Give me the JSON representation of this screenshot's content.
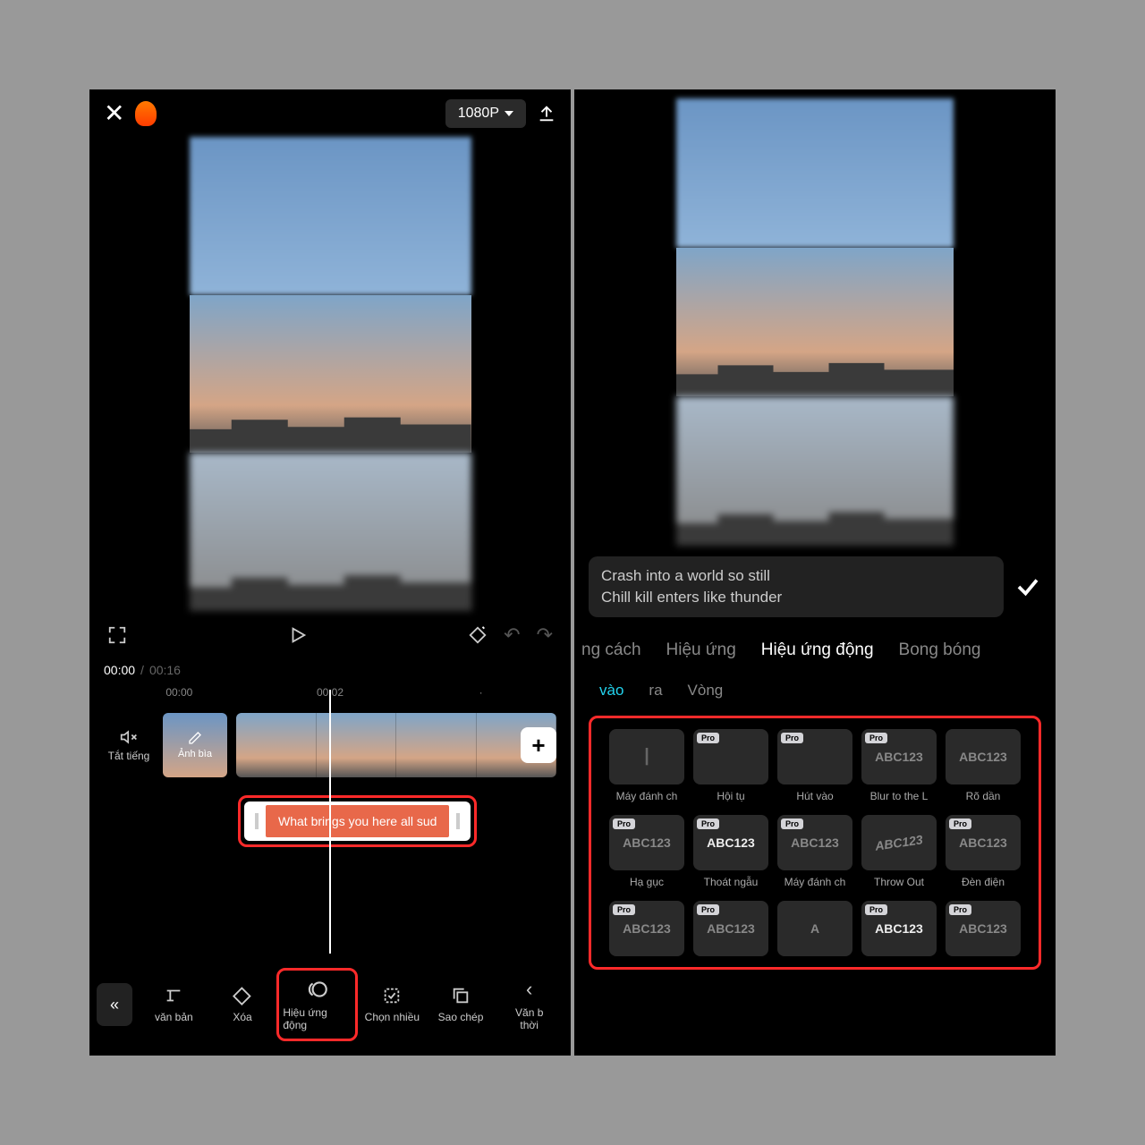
{
  "left": {
    "resolution": "1080P",
    "overlay": {
      "line1": "What brings you here all sudden?",
      "line2": "Crash into a world so still",
      "line3": "Chill kill enters like thunder"
    },
    "time": {
      "current": "00:00",
      "total": "00:16"
    },
    "marks": {
      "t1": "00:00",
      "t2": "00:02"
    },
    "mute": "Tắt tiếng",
    "cover": "Ảnh bìa",
    "textClip": "What brings you here all sud",
    "tools": {
      "text": "văn bản",
      "delete": "Xóa",
      "anim": "Hiệu ứng động",
      "multi": "Chọn nhiều",
      "copy": "Sao chép",
      "time": "Văn b\nthời"
    }
  },
  "right": {
    "overlay": {
      "line1": "What brings you here all sudden?",
      "line2": "Crash into a world so still",
      "line3": "Chill kill enters like thunder"
    },
    "lyrics": {
      "l1": "Crash into a world so still",
      "l2": "Chill kill enters like thunder"
    },
    "tabs": {
      "t1": "ng cách",
      "t2": "Hiệu ứng",
      "t3": "Hiệu ứng động",
      "t4": "Bong bóng"
    },
    "subtabs": {
      "s1": "vào",
      "s2": "ra",
      "s3": "Vòng"
    },
    "pro": "Pro",
    "abc": "ABC123",
    "fx": [
      {
        "label": "Máy đánh ch",
        "txt": "",
        "pro": false
      },
      {
        "label": "Hội tụ",
        "txt": "",
        "pro": true
      },
      {
        "label": "Hút vào",
        "txt": "",
        "pro": true
      },
      {
        "label": "Blur to the L",
        "txt": "ABC123",
        "pro": true
      },
      {
        "label": "Rõ dần",
        "txt": "ABC123",
        "pro": false
      },
      {
        "label": "Hạ gục",
        "txt": "ABC123",
        "pro": true
      },
      {
        "label": "Thoát ngẫu",
        "txt": "ABC123",
        "pro": true
      },
      {
        "label": "Máy đánh ch",
        "txt": "ABC123",
        "pro": true
      },
      {
        "label": "Throw Out",
        "txt": "ABC123",
        "pro": false,
        "tilt": true
      },
      {
        "label": "Đèn điện",
        "txt": "ABC123",
        "pro": true
      },
      {
        "label": "",
        "txt": "ABC123",
        "pro": true
      },
      {
        "label": "",
        "txt": "ABC123",
        "pro": true
      },
      {
        "label": "",
        "txt": "A",
        "pro": false
      },
      {
        "label": "",
        "txt": "ABC123",
        "pro": true
      },
      {
        "label": "",
        "txt": "ABC123",
        "pro": true
      }
    ]
  }
}
